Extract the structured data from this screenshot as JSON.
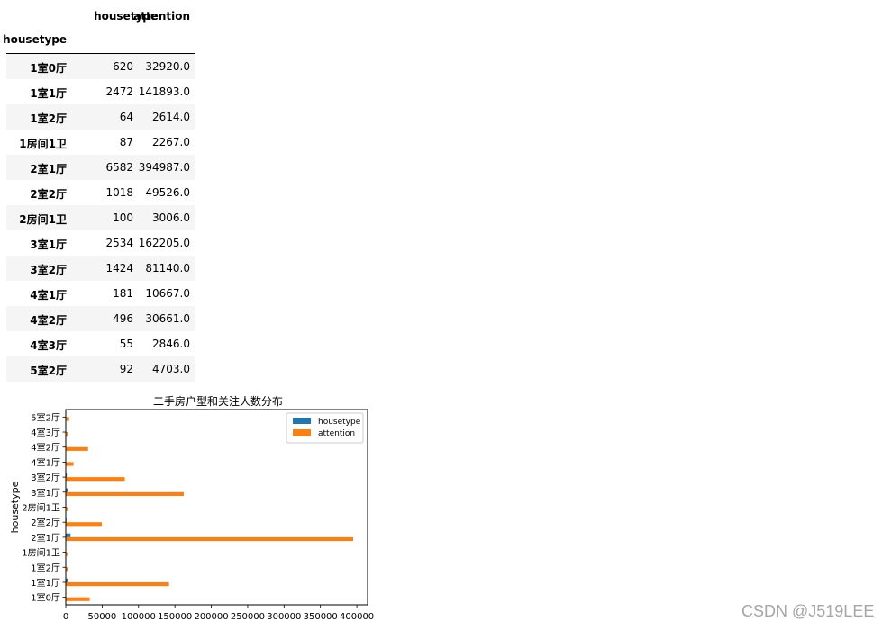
{
  "table": {
    "columns": [
      "housetype",
      "attention"
    ],
    "index_name": "housetype",
    "rows": [
      {
        "index": "1室0厅",
        "housetype": "620",
        "attention": "32920.0"
      },
      {
        "index": "1室1厅",
        "housetype": "2472",
        "attention": "141893.0"
      },
      {
        "index": "1室2厅",
        "housetype": "64",
        "attention": "2614.0"
      },
      {
        "index": "1房间1卫",
        "housetype": "87",
        "attention": "2267.0"
      },
      {
        "index": "2室1厅",
        "housetype": "6582",
        "attention": "394987.0"
      },
      {
        "index": "2室2厅",
        "housetype": "1018",
        "attention": "49526.0"
      },
      {
        "index": "2房间1卫",
        "housetype": "100",
        "attention": "3006.0"
      },
      {
        "index": "3室1厅",
        "housetype": "2534",
        "attention": "162205.0"
      },
      {
        "index": "3室2厅",
        "housetype": "1424",
        "attention": "81140.0"
      },
      {
        "index": "4室1厅",
        "housetype": "181",
        "attention": "10667.0"
      },
      {
        "index": "4室2厅",
        "housetype": "496",
        "attention": "30661.0"
      },
      {
        "index": "4室3厅",
        "housetype": "55",
        "attention": "2846.0"
      },
      {
        "index": "5室2厅",
        "housetype": "92",
        "attention": "4703.0"
      }
    ]
  },
  "chart_data": {
    "type": "bar",
    "orientation": "horizontal",
    "title": "二手房户型和关注人数分布",
    "ylabel": "housetype",
    "xlabel": "",
    "categories": [
      "1室0厅",
      "1室1厅",
      "1室2厅",
      "1房间1卫",
      "2室1厅",
      "2室2厅",
      "2房间1卫",
      "3室1厅",
      "3室2厅",
      "4室1厅",
      "4室2厅",
      "4室3厅",
      "5室2厅"
    ],
    "series": [
      {
        "name": "housetype",
        "color": "#1f77b4",
        "values": [
          620,
          2472,
          64,
          87,
          6582,
          1018,
          100,
          2534,
          1424,
          181,
          496,
          55,
          92
        ]
      },
      {
        "name": "attention",
        "color": "#ff7f0e",
        "values": [
          32920,
          141893,
          2614,
          2267,
          394987,
          49526,
          3006,
          162205,
          81140,
          10667,
          30661,
          2846,
          4703
        ]
      }
    ],
    "xlim": [
      0,
      414737
    ],
    "xticks": [
      0,
      50000,
      100000,
      150000,
      200000,
      250000,
      300000,
      350000,
      400000
    ],
    "grid": false,
    "legend_position": "top-right"
  },
  "watermark": "CSDN @J519LEE"
}
